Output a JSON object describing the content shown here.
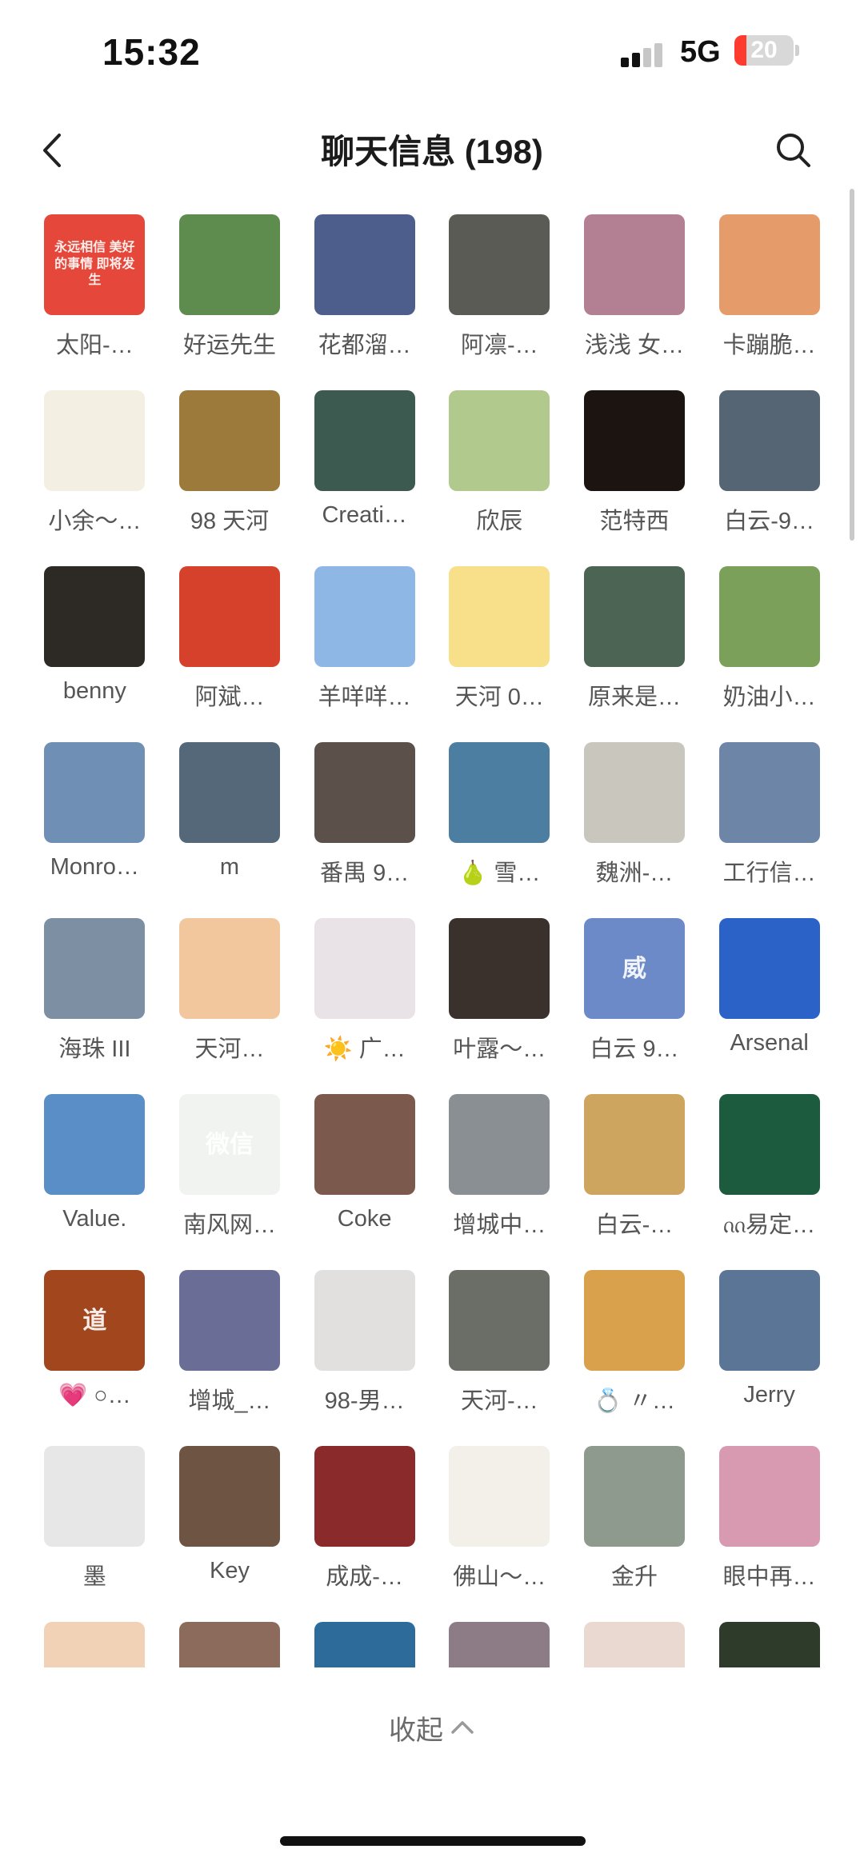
{
  "status_bar": {
    "time": "15:32",
    "network": "5G",
    "battery": "20",
    "battery_level": 0.2,
    "battery_color": "#ff3b30"
  },
  "header": {
    "title": "聊天信息 (198)",
    "back_icon": "chevron-left-icon",
    "search_icon": "search-icon"
  },
  "members": [
    {
      "name": "太阳-…",
      "avatar_color": "#e5483a",
      "avatar_text": "永远相信 美好的事情 即将发生"
    },
    {
      "name": "好运先生",
      "avatar_color": "#5e8b4e",
      "avatar_text": ""
    },
    {
      "name": "花都溜…",
      "avatar_color": "#4d5e8c",
      "avatar_text": ""
    },
    {
      "name": "阿凛-…",
      "avatar_color": "#5b5b55",
      "avatar_text": ""
    },
    {
      "name": "浅浅 女…",
      "avatar_color": "#b27f93",
      "avatar_text": ""
    },
    {
      "name": "卡蹦脆…",
      "avatar_color": "#e69b6a",
      "avatar_text": ""
    },
    {
      "name": "小余～…",
      "avatar_color": "#f4efe3",
      "avatar_text": ""
    },
    {
      "name": "98 天河",
      "avatar_color": "#9b7a3b",
      "avatar_text": ""
    },
    {
      "name": "Creati…",
      "avatar_color": "#3c5a4f",
      "avatar_text": ""
    },
    {
      "name": "欣辰",
      "avatar_color": "#b2c98d",
      "avatar_text": ""
    },
    {
      "name": "范特西",
      "avatar_color": "#1c1410",
      "avatar_text": ""
    },
    {
      "name": "白云-9…",
      "avatar_color": "#556574",
      "avatar_text": ""
    },
    {
      "name": "benny",
      "avatar_color": "#2d2a25",
      "avatar_text": ""
    },
    {
      "name": "阿斌…",
      "avatar_color": "#d6412c",
      "avatar_text": ""
    },
    {
      "name": "羊咩咩…",
      "avatar_color": "#8fb7e6",
      "avatar_text": ""
    },
    {
      "name": "天河 0…",
      "avatar_color": "#f8e08a",
      "avatar_text": ""
    },
    {
      "name": "原来是…",
      "avatar_color": "#4c6453",
      "avatar_text": ""
    },
    {
      "name": "奶油小…",
      "avatar_color": "#7aa05a",
      "avatar_text": ""
    },
    {
      "name": "Monro…",
      "avatar_color": "#6f8fb4",
      "avatar_text": ""
    },
    {
      "name": "m",
      "avatar_color": "#54687a",
      "avatar_text": ""
    },
    {
      "name": "番禺 9…",
      "avatar_color": "#5c514a",
      "avatar_text": ""
    },
    {
      "name": "🍐 雪…",
      "avatar_color": "#4b7ea0",
      "avatar_text": ""
    },
    {
      "name": "魏洲-…",
      "avatar_color": "#c9c6bd",
      "avatar_text": ""
    },
    {
      "name": "工行信…",
      "avatar_color": "#6d86a8",
      "avatar_text": ""
    },
    {
      "name": "海珠 III",
      "avatar_color": "#7d8fa3",
      "avatar_text": ""
    },
    {
      "name": "天河…",
      "avatar_color": "#f2c79d",
      "avatar_text": ""
    },
    {
      "name": "☀️ 广…",
      "avatar_color": "#e9e3e8",
      "avatar_text": ""
    },
    {
      "name": "叶露～…",
      "avatar_color": "#3a302c",
      "avatar_text": ""
    },
    {
      "name": "白云 9…",
      "avatar_color": "#6c89c8",
      "avatar_text": "威"
    },
    {
      "name": "Arsenal",
      "avatar_color": "#2a62c7",
      "avatar_text": ""
    },
    {
      "name": "Value.",
      "avatar_color": "#5a8ec7",
      "avatar_text": ""
    },
    {
      "name": "南风网…",
      "avatar_color": "#f1f3f1",
      "avatar_text": "微信"
    },
    {
      "name": "Coke",
      "avatar_color": "#7b5a4d",
      "avatar_text": ""
    },
    {
      "name": "增城中…",
      "avatar_color": "#8a8f93",
      "avatar_text": ""
    },
    {
      "name": "白云-…",
      "avatar_color": "#cda55f",
      "avatar_text": ""
    },
    {
      "name": "ᦶ易定…",
      "avatar_color": "#1c5b3e",
      "avatar_text": ""
    },
    {
      "name": "💗 ○…",
      "avatar_color": "#a2461e",
      "avatar_text": "道"
    },
    {
      "name": "增城_…",
      "avatar_color": "#6a6e96",
      "avatar_text": ""
    },
    {
      "name": "98-男…",
      "avatar_color": "#e2e0df",
      "avatar_text": ""
    },
    {
      "name": "天河-…",
      "avatar_color": "#6a6e66",
      "avatar_text": ""
    },
    {
      "name": "💍 〃…",
      "avatar_color": "#d9a14b",
      "avatar_text": ""
    },
    {
      "name": "Jerry",
      "avatar_color": "#5a7596",
      "avatar_text": ""
    },
    {
      "name": "墨",
      "avatar_color": "#e7e7e7",
      "avatar_text": ""
    },
    {
      "name": "Key",
      "avatar_color": "#6e5442",
      "avatar_text": ""
    },
    {
      "name": "成成-…",
      "avatar_color": "#8b2a2a",
      "avatar_text": ""
    },
    {
      "name": "佛山～…",
      "avatar_color": "#f3efe9",
      "avatar_text": ""
    },
    {
      "name": "金升",
      "avatar_color": "#8e9a8d",
      "avatar_text": ""
    },
    {
      "name": "眼中再…",
      "avatar_color": "#d79ab0",
      "avatar_text": ""
    },
    {
      "name": "",
      "avatar_color": "#f1d2b6",
      "avatar_text": ""
    },
    {
      "name": "",
      "avatar_color": "#8d6b5c",
      "avatar_text": ""
    },
    {
      "name": "",
      "avatar_color": "#2d6c9a",
      "avatar_text": ""
    },
    {
      "name": "",
      "avatar_color": "#8d7b86",
      "avatar_text": ""
    },
    {
      "name": "",
      "avatar_color": "#ead9d1",
      "avatar_text": ""
    },
    {
      "name": "",
      "avatar_color": "#2e3a2a",
      "avatar_text": ""
    }
  ],
  "footer": {
    "collapse_label": "收起",
    "collapse_icon": "chevron-up-icon"
  }
}
